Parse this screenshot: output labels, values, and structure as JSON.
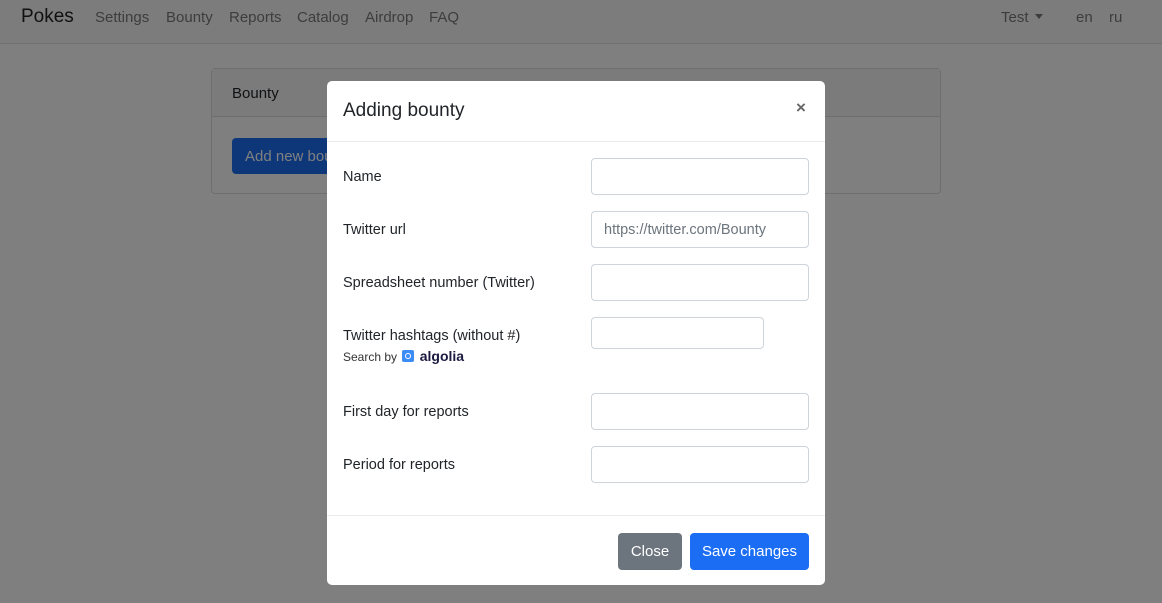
{
  "navbar": {
    "brand": "Pokes",
    "links": [
      "Settings",
      "Bounty",
      "Reports",
      "Catalog",
      "Airdrop",
      "FAQ"
    ],
    "user": "Test",
    "languages": [
      "en",
      "ru"
    ]
  },
  "card": {
    "title": "Bounty",
    "add_button": "Add new bounty"
  },
  "modal": {
    "title": "Adding bounty",
    "close_symbol": "×",
    "fields": {
      "name": {
        "label": "Name",
        "value": "",
        "placeholder": ""
      },
      "twitter_url": {
        "label": "Twitter url",
        "value": "",
        "placeholder": "https://twitter.com/Bounty"
      },
      "spreadsheet": {
        "label": "Spreadsheet number (Twitter)",
        "value": "",
        "placeholder": ""
      },
      "hashtags": {
        "label": "Twitter hashtags (without #)",
        "value": "",
        "placeholder": ""
      },
      "first_day": {
        "label": "First day for reports",
        "value": "",
        "placeholder": ""
      },
      "period": {
        "label": "Period for reports",
        "value": "",
        "placeholder": ""
      }
    },
    "algolia": {
      "prefix": "Search by",
      "brand": "algolia"
    },
    "footer": {
      "close_label": "Close",
      "save_label": "Save changes"
    }
  },
  "colors": {
    "primary": "#1b6ef3",
    "secondary": "#6c757d",
    "backdrop": "rgba(0,0,0,0.5)"
  }
}
